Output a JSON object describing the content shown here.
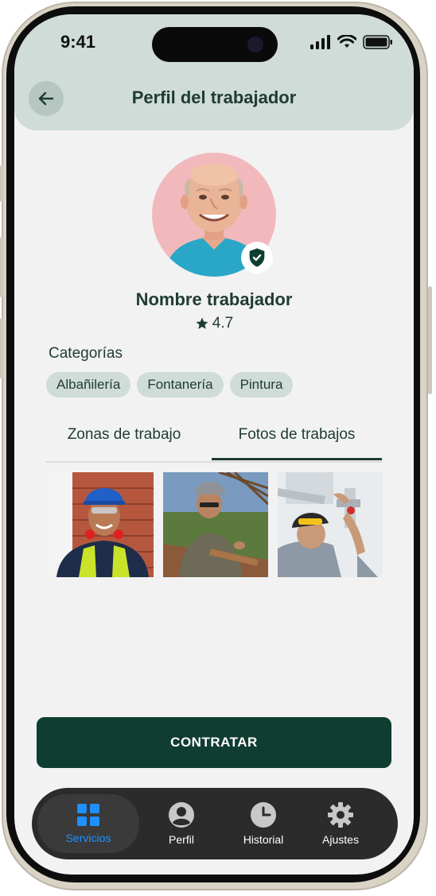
{
  "status_bar": {
    "time": "9:41"
  },
  "header": {
    "title": "Perfil del trabajador"
  },
  "profile": {
    "name": "Nombre trabajador",
    "rating": "4.7"
  },
  "categories": {
    "label": "Categorías",
    "items": [
      "Albañilería",
      "Fontanería",
      "Pintura"
    ]
  },
  "tabs": [
    {
      "label": "Zonas de trabajo",
      "active": false
    },
    {
      "label": "Fotos de trabajos",
      "active": true
    }
  ],
  "actions": {
    "hire_label": "CONTRATAR"
  },
  "bottom_nav": [
    {
      "label": "Servicios",
      "icon": "grid-icon",
      "active": true
    },
    {
      "label": "Perfil",
      "icon": "user-circle-icon",
      "active": false
    },
    {
      "label": "Historial",
      "icon": "clock-icon",
      "active": false
    },
    {
      "label": "Ajustes",
      "icon": "gear-icon",
      "active": false
    }
  ],
  "colors": {
    "primary": "#0f3d31",
    "header_bg": "#cfdcd7",
    "accent_blue": "#1e90ff"
  }
}
